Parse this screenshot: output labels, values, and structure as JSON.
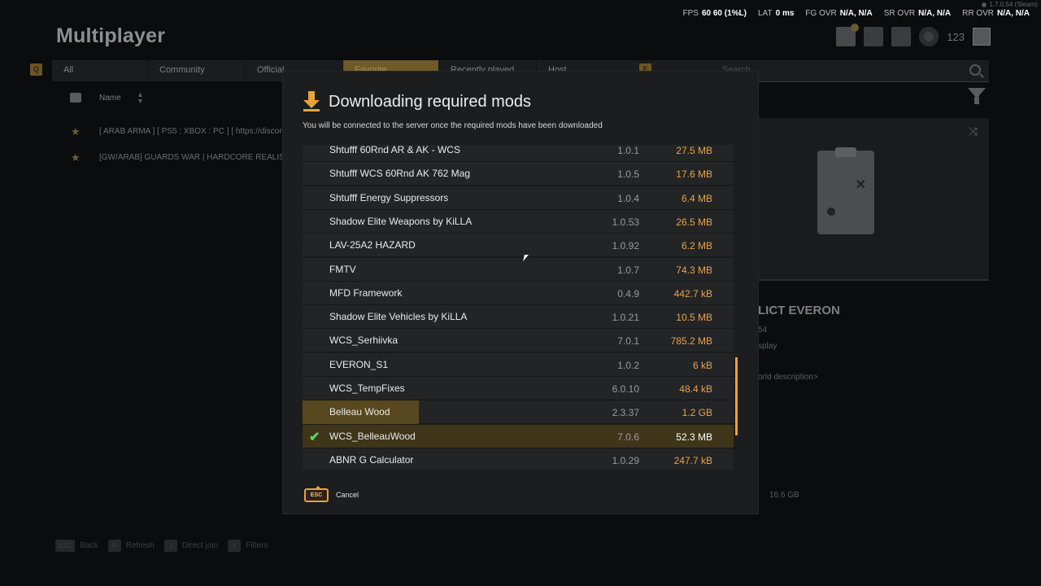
{
  "version": "1.7.0.54 (Steam)",
  "perf": [
    {
      "label": "FPS",
      "values": "60   60 (1%L)"
    },
    {
      "label": "LAT",
      "values": "0 ms"
    },
    {
      "label": "FG OVR",
      "values": "N/A, N/A"
    },
    {
      "label": "SR OVR",
      "values": "N/A, N/A"
    },
    {
      "label": "RR OVR",
      "values": "N/A, N/A"
    }
  ],
  "page_title": "Multiplayer",
  "header": {
    "player_count": "123"
  },
  "tabs": [
    {
      "label": "All"
    },
    {
      "label": "Community"
    },
    {
      "label": "Official"
    },
    {
      "label": "Favorite"
    },
    {
      "label": "Recently played"
    },
    {
      "label": "Host"
    }
  ],
  "tab_hints": {
    "left": "Q",
    "right": "E"
  },
  "search": {
    "placeholder": "Search"
  },
  "list_header": {
    "name": "Name"
  },
  "servers": [
    {
      "name": "[ ARAB ARMA ] [ PS5 : XBOX : PC ] [ https://discord.gg"
    },
    {
      "name": "[GW/ARAB] GUARDS WAR | HARDCORE REALISM | PS5"
    }
  ],
  "world": {
    "name": "LICT EVERON",
    "version": "54",
    "mode": "splay",
    "description": "orld description>",
    "size": "16.6 GB"
  },
  "bottom_hints": [
    {
      "key": "ESC",
      "label": "Back"
    },
    {
      "key": "R",
      "label": "Refresh"
    },
    {
      "key": "J",
      "label": "Direct join"
    },
    {
      "key": "X",
      "label": "Filters"
    }
  ],
  "modal": {
    "title": "Downloading required mods",
    "subtitle": "You will be connected to the server once the required mods have been downloaded",
    "cancel_key": "ESC",
    "cancel_label": "Cancel",
    "mods": [
      {
        "name": "Shtufff 60Rnd AR & AK - WCS",
        "version": "1.0.1",
        "size": "27.5 MB",
        "state": "queued"
      },
      {
        "name": "Shtufff WCS 60Rnd AK 762 Mag",
        "version": "1.0.5",
        "size": "17.6 MB",
        "state": "queued"
      },
      {
        "name": "Shtufff Energy Suppressors",
        "version": "1.0.4",
        "size": "6.4 MB",
        "state": "queued"
      },
      {
        "name": "Shadow Elite Weapons by KiLLA",
        "version": "1.0.53",
        "size": "26.5 MB",
        "state": "queued"
      },
      {
        "name": "LAV-25A2 HAZARD",
        "version": "1.0.92",
        "size": "6.2 MB",
        "state": "queued"
      },
      {
        "name": "FMTV",
        "version": "1.0.7",
        "size": "74.3 MB",
        "state": "queued"
      },
      {
        "name": "MFD Framework",
        "version": "0.4.9",
        "size": "442.7 kB",
        "state": "queued"
      },
      {
        "name": "Shadow Elite Vehicles by KiLLA",
        "version": "1.0.21",
        "size": "10.5 MB",
        "state": "queued"
      },
      {
        "name": "WCS_Serhiivka",
        "version": "7.0.1",
        "size": "785.2 MB",
        "state": "queued"
      },
      {
        "name": "EVERON_S1",
        "version": "1.0.2",
        "size": "6 kB",
        "state": "queued"
      },
      {
        "name": "WCS_TempFixes",
        "version": "6.0.10",
        "size": "48.4 kB",
        "state": "queued"
      },
      {
        "name": "Belleau Wood",
        "version": "2.3.37",
        "size": "1.2 GB",
        "state": "downloading",
        "progress": 0.27
      },
      {
        "name": "WCS_BelleauWood",
        "version": "7.0.6",
        "size": "52.3 MB",
        "state": "downloaded"
      },
      {
        "name": "ABNR G Calculator",
        "version": "1.0.29",
        "size": "247.7 kB",
        "state": "queued"
      }
    ],
    "scroll_position": 0.86,
    "scroll_visible_fraction": 0.24
  }
}
